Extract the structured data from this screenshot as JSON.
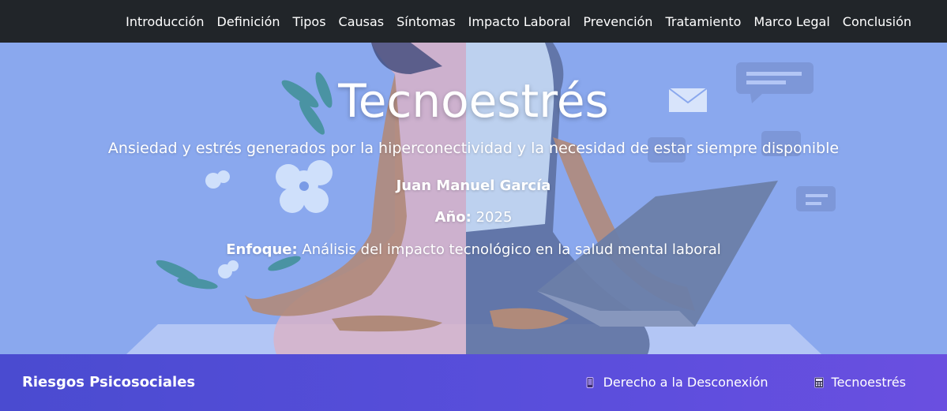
{
  "nav": {
    "items": [
      {
        "label": "Introducción"
      },
      {
        "label": "Definición"
      },
      {
        "label": "Tipos"
      },
      {
        "label": "Causas"
      },
      {
        "label": "Síntomas"
      },
      {
        "label": "Impacto Laboral"
      },
      {
        "label": "Prevención"
      },
      {
        "label": "Tratamiento"
      },
      {
        "label": "Marco Legal"
      },
      {
        "label": "Conclusión"
      }
    ]
  },
  "hero": {
    "title": "Tecnoestrés",
    "subtitle": "Ansiedad y estrés generados por la hiperconectividad y la necesidad de estar siempre disponible",
    "author": "Juan Manuel García",
    "year_label": "Año:",
    "year_value": "2025",
    "focus_label": "Enfoque:",
    "focus_value": "Análisis del impacto tecnológico en la salud mental laboral",
    "background_color": "#8aa8ee"
  },
  "footer": {
    "brand": "Riesgos Psicosociales",
    "links": [
      {
        "icon": "mobile-phone-icon",
        "label": "Derecho a la Desconexión"
      },
      {
        "icon": "calculator-icon",
        "label": "Tecnoestrés"
      }
    ],
    "gradient": [
      "#4a4bd0",
      "#6a4fe0"
    ]
  }
}
